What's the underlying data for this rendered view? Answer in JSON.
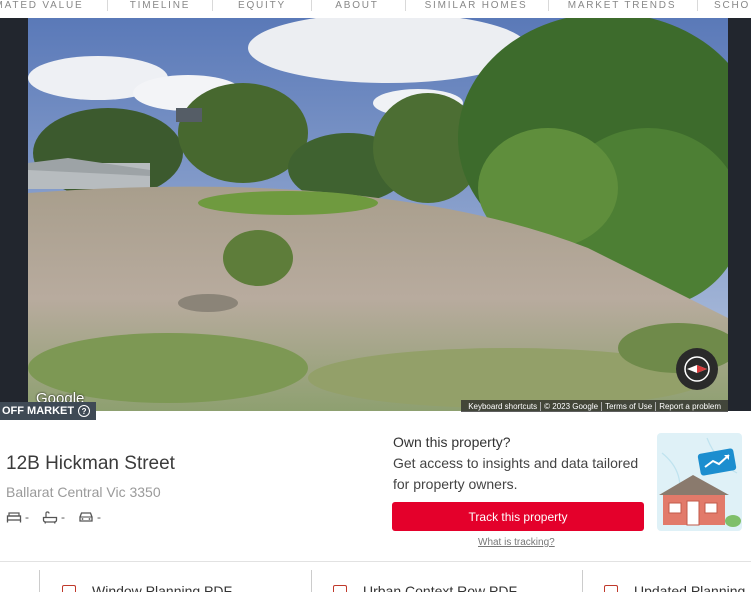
{
  "nav": {
    "items": [
      "MATED VALUE",
      "TIMELINE",
      "EQUITY",
      "ABOUT",
      "SIMILAR HOMES",
      "MARKET TRENDS",
      "SCHO"
    ]
  },
  "streetview": {
    "google_logo": "Google",
    "attribution": [
      "Keyboard shortcuts",
      "© 2023 Google",
      "Terms of Use",
      "Report a problem"
    ]
  },
  "status": {
    "badge": "OFF MARKET",
    "help_icon": "?"
  },
  "property": {
    "address": "12B Hickman Street",
    "suburb": "Ballarat Central Vic 3350",
    "beds": "-",
    "baths": "-",
    "cars": "-"
  },
  "own": {
    "title": "Own this property?",
    "description": "Get access to insights and data tailored for property owners.",
    "button": "Track this property",
    "link": "What is tracking?"
  },
  "documents": [
    "Window Planning PDF",
    "Urban Context Row PDF",
    "Updated Planning"
  ],
  "colors": {
    "accent": "#e4002b",
    "dark_panel": "#22262e",
    "badge": "#3f4a55"
  }
}
